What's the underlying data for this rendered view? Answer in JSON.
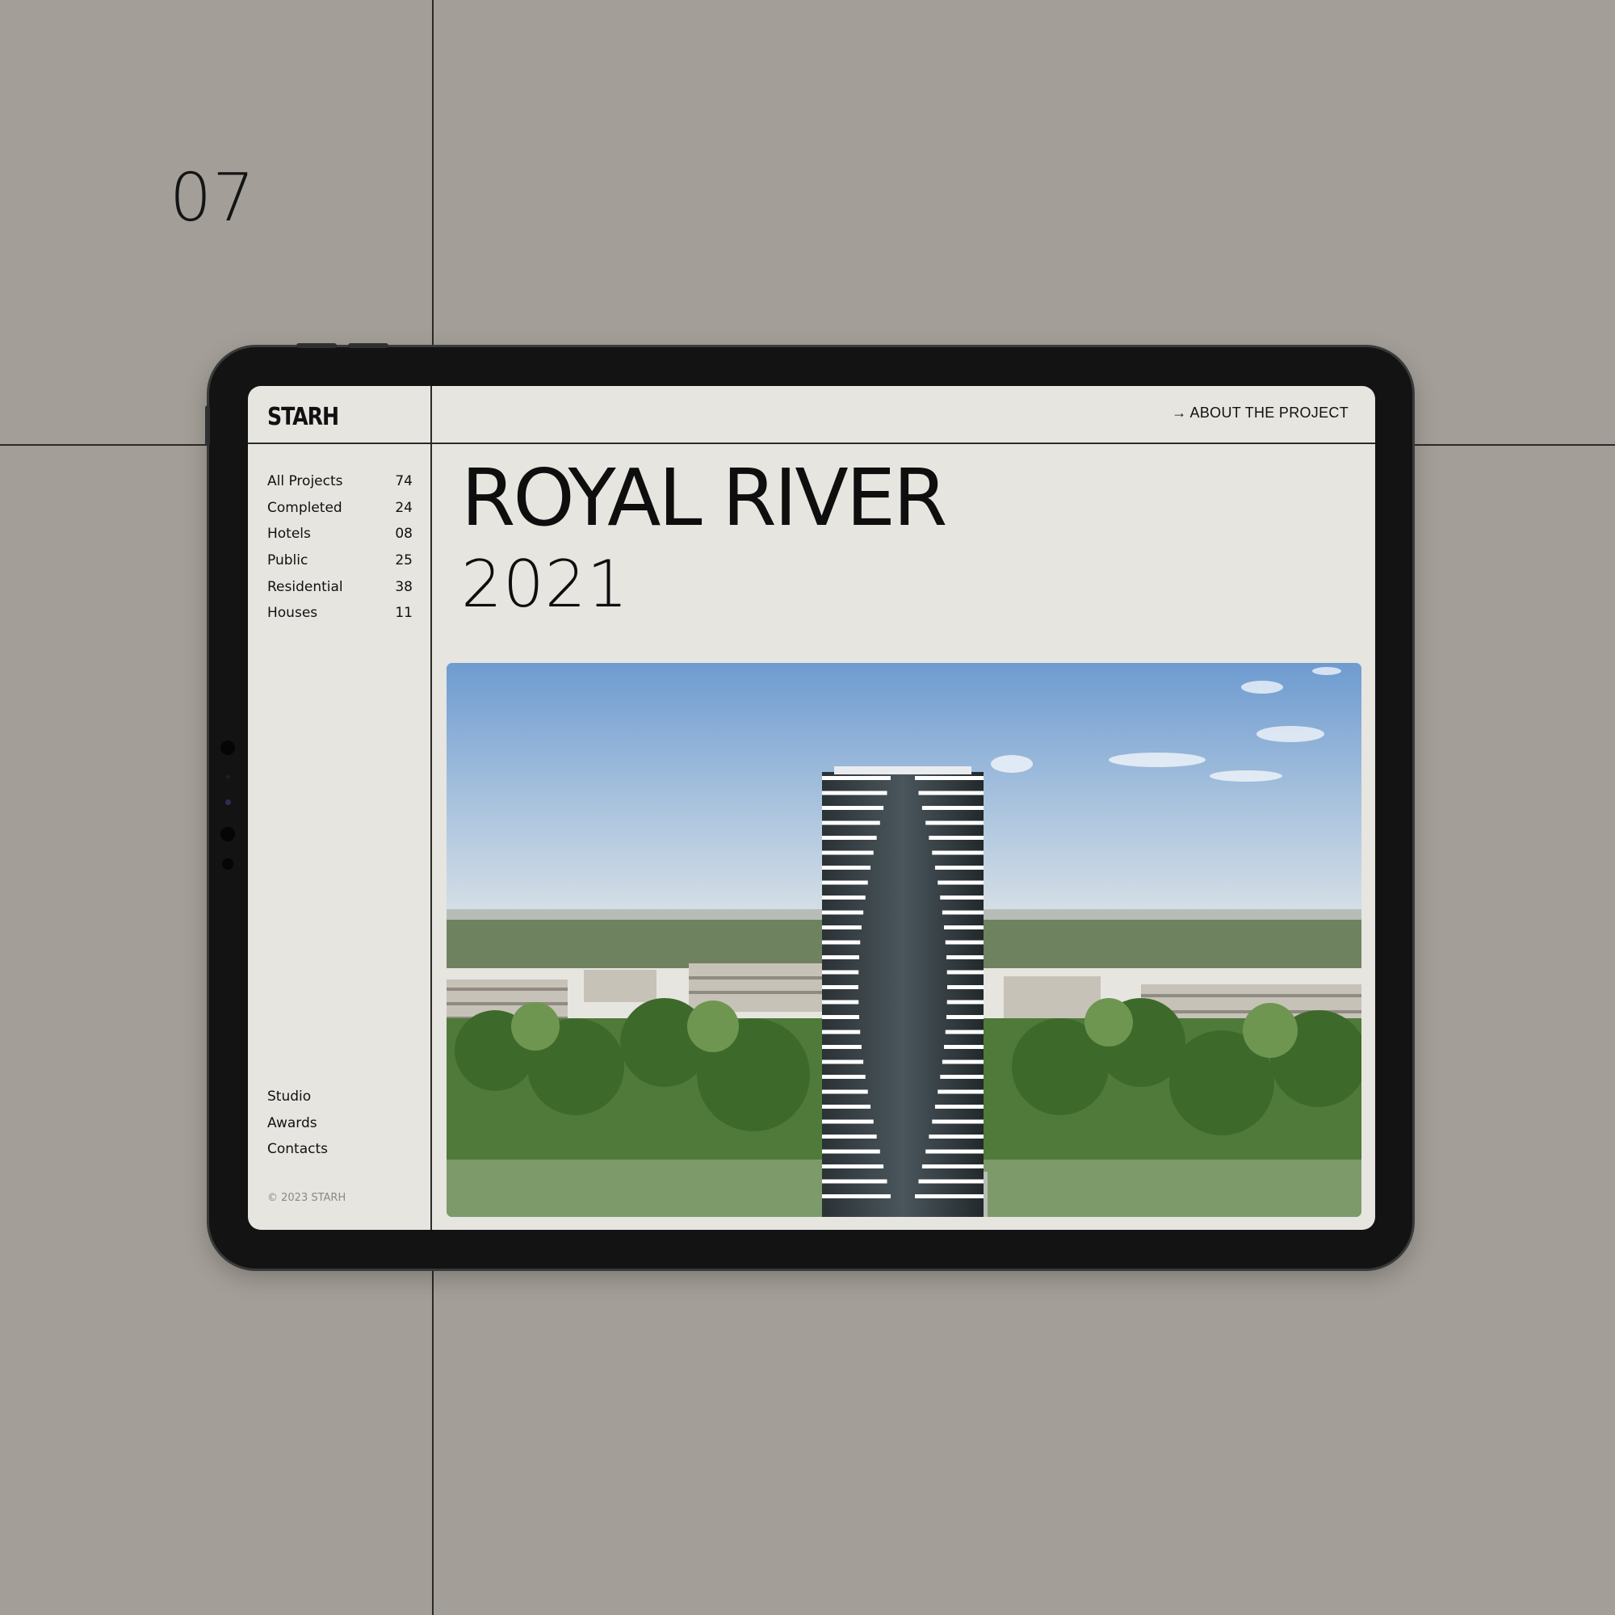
{
  "slide": {
    "number": "07"
  },
  "header": {
    "logo": "STARH",
    "about_link": "ABOUT THE PROJECT",
    "about_arrow": "→"
  },
  "sidebar": {
    "categories": [
      {
        "label": "All Projects",
        "count": "74"
      },
      {
        "label": "Completed",
        "count": "24"
      },
      {
        "label": "Hotels",
        "count": "08"
      },
      {
        "label": "Public",
        "count": "25"
      },
      {
        "label": "Residential",
        "count": "38"
      },
      {
        "label": "Houses",
        "count": "11"
      }
    ],
    "footer_links": [
      "Studio",
      "Awards",
      "Contacts"
    ],
    "copyright": "© 2023 STARH"
  },
  "project": {
    "title": "ROYAL RIVER",
    "year": "2021"
  },
  "colors": {
    "backdrop": "#a39e97",
    "screen": "#e6e5e0",
    "device_frame": "#131313",
    "text": "#111111"
  }
}
